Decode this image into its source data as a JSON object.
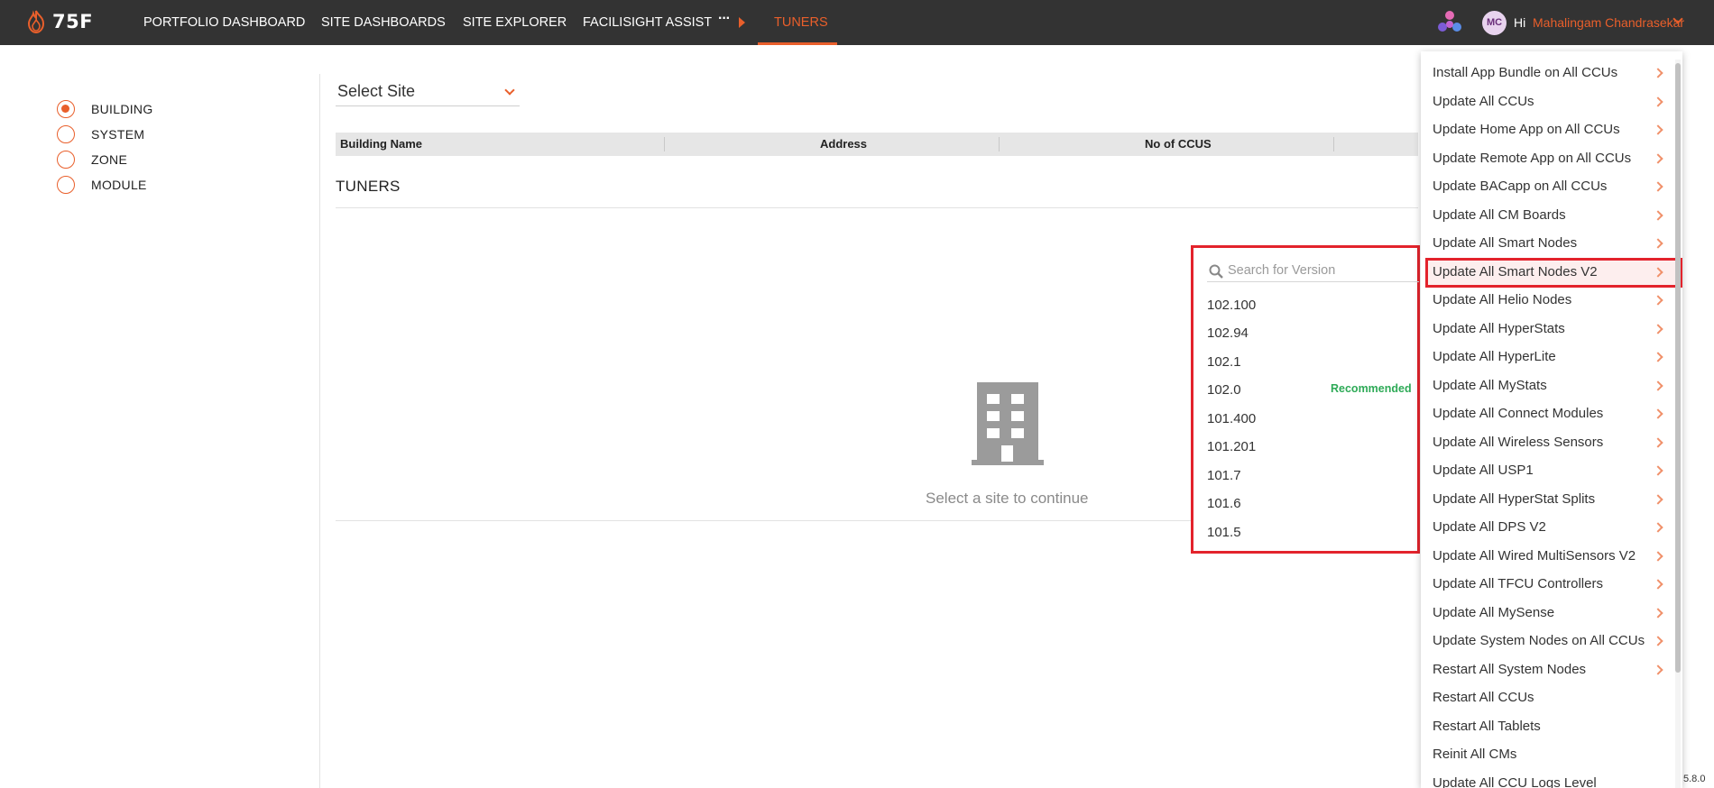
{
  "app": {
    "brand": "75F"
  },
  "nav": {
    "items": [
      {
        "label": "PORTFOLIO DASHBOARD"
      },
      {
        "label": "SITE DASHBOARDS"
      },
      {
        "label": "SITE EXPLORER"
      },
      {
        "label": "FACILISIGHT ASSIST"
      },
      {
        "label": "TUNERS"
      }
    ],
    "more": "···",
    "active_color": "#e95f2b"
  },
  "user": {
    "initials": "MC",
    "greeting": "Hi",
    "name": "Mahalingam Chandrasekar"
  },
  "levels": [
    {
      "label": "BUILDING",
      "checked": true
    },
    {
      "label": "SYSTEM",
      "checked": false
    },
    {
      "label": "ZONE",
      "checked": false
    },
    {
      "label": "MODULE",
      "checked": false
    }
  ],
  "site_select": {
    "label": "Select Site"
  },
  "table": {
    "columns": [
      "Building Name",
      "Address",
      "No of CCUS"
    ]
  },
  "tuners": {
    "title": "TUNERS",
    "empty_message": "Select a site to continue"
  },
  "version_dropdown": {
    "search_placeholder": "Search for Version",
    "versions": [
      "102.100",
      "102.94",
      "102.1",
      "102.0",
      "101.400",
      "101.201",
      "101.7",
      "101.6",
      "101.5"
    ],
    "recommended_label": "Recommended",
    "recommended_version": "102.0",
    "recommended_color": "#2eaa57"
  },
  "action_menu": {
    "items": [
      {
        "label": "Install App Bundle on All CCUs",
        "submenu": true
      },
      {
        "label": "Update All CCUs",
        "submenu": true
      },
      {
        "label": "Update Home App on All CCUs",
        "submenu": true
      },
      {
        "label": "Update Remote App on All CCUs",
        "submenu": true
      },
      {
        "label": "Update BACapp on All CCUs",
        "submenu": true
      },
      {
        "label": "Update All CM Boards",
        "submenu": true
      },
      {
        "label": "Update All Smart Nodes",
        "submenu": true
      },
      {
        "label": "Update All Smart Nodes V2",
        "submenu": true,
        "highlighted": true
      },
      {
        "label": "Update All Helio Nodes",
        "submenu": true
      },
      {
        "label": "Update All HyperStats",
        "submenu": true
      },
      {
        "label": "Update All HyperLite",
        "submenu": true
      },
      {
        "label": "Update All MyStats",
        "submenu": true
      },
      {
        "label": "Update All Connect Modules",
        "submenu": true
      },
      {
        "label": "Update All Wireless Sensors",
        "submenu": true
      },
      {
        "label": "Update All USP1",
        "submenu": true
      },
      {
        "label": "Update All HyperStat Splits",
        "submenu": true
      },
      {
        "label": "Update All DPS V2",
        "submenu": true
      },
      {
        "label": "Update All Wired MultiSensors V2",
        "submenu": true
      },
      {
        "label": "Update All TFCU Controllers",
        "submenu": true
      },
      {
        "label": "Update All MySense",
        "submenu": true
      },
      {
        "label": "Update System Nodes on All CCUs",
        "submenu": true
      },
      {
        "label": "Restart All System Nodes",
        "submenu": true
      },
      {
        "label": "Restart All CCUs",
        "submenu": false
      },
      {
        "label": "Restart All Tablets",
        "submenu": false
      },
      {
        "label": "Reinit All CMs",
        "submenu": false
      },
      {
        "label": "Update All CCU Logs Level",
        "submenu": false
      }
    ],
    "highlight_color": "#e3232c"
  },
  "app_version": "5.8.0"
}
